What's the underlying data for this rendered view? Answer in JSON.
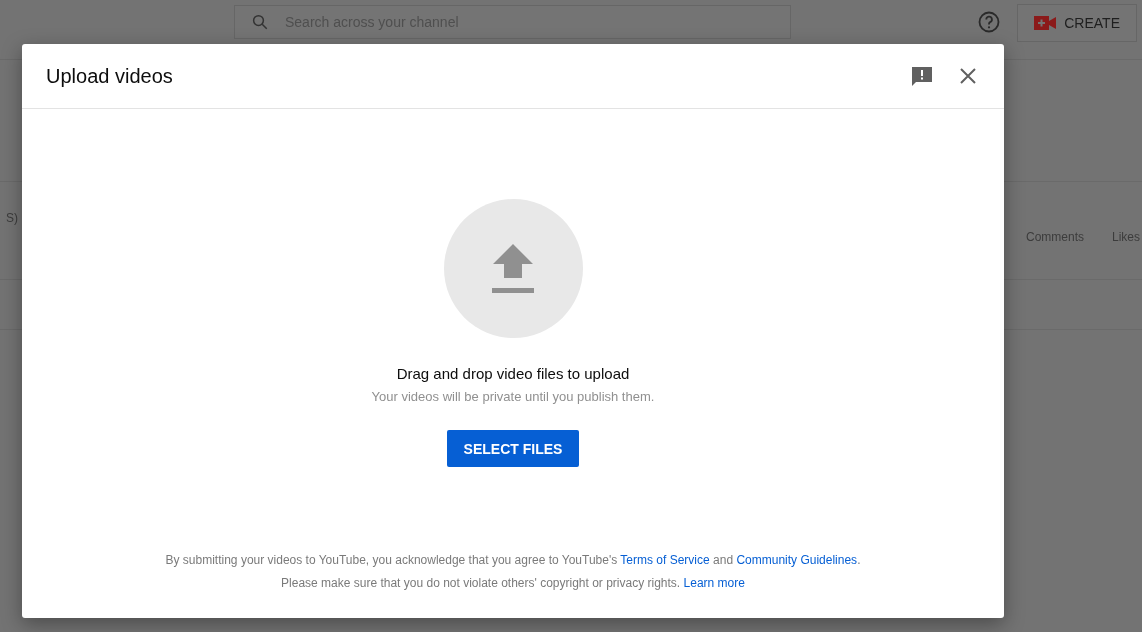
{
  "topbar": {
    "search": {
      "placeholder": "Search across your channel"
    },
    "create_button": "CREATE"
  },
  "background": {
    "left_label": "S)",
    "columns": [
      "Comments",
      "Likes"
    ]
  },
  "dialog": {
    "title": "Upload videos",
    "prompt": "Drag and drop video files to upload",
    "subtext": "Your videos will be private until you publish them.",
    "button": "SELECT FILES",
    "footer": [
      [
        {
          "kind": "text",
          "text": "By submitting your videos to YouTube, you acknowledge that you agree to YouTube's "
        },
        {
          "kind": "link",
          "text": "Terms of Service"
        },
        {
          "kind": "text",
          "text": " and "
        },
        {
          "kind": "link",
          "text": "Community Guidelines"
        },
        {
          "kind": "text",
          "text": "."
        }
      ],
      [
        {
          "kind": "text",
          "text": "Please make sure that you do not violate others' copyright or privacy rights. "
        },
        {
          "kind": "link",
          "text": "Learn more"
        }
      ]
    ]
  }
}
